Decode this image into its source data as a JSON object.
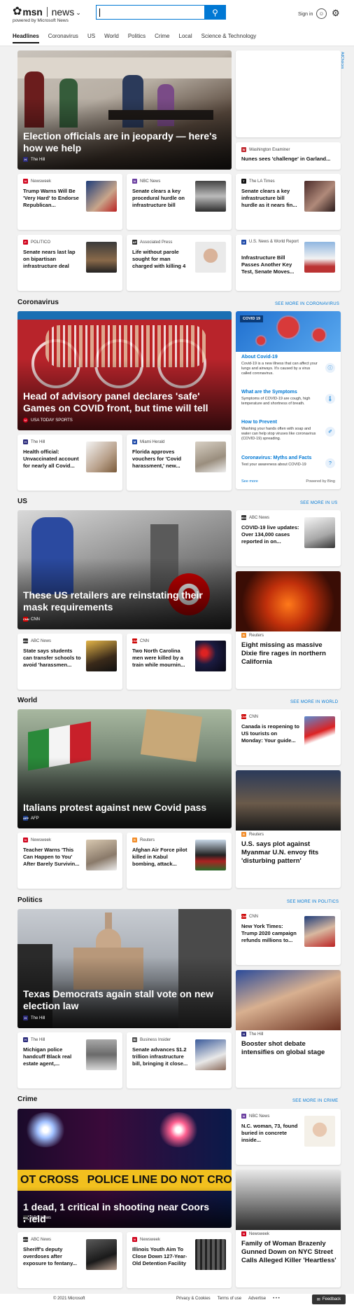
{
  "header": {
    "brand": "msn",
    "section": "news",
    "powered_by": "powered by Microsoft News",
    "signin": "Sign in"
  },
  "tabs": [
    "Headlines",
    "Coronavirus",
    "US",
    "World",
    "Politics",
    "Crime",
    "Local",
    "Science & Technology"
  ],
  "adchoices": "AdChoices",
  "top": {
    "hero": {
      "title": "Election officials are in jeopardy — here's how we help",
      "source": "The Hill"
    },
    "side": {
      "source": "Washington Examiner",
      "title": "Nunes sees 'challenge' in Garland..."
    },
    "cards": [
      {
        "source": "Newsweek",
        "title": "Trump Warns Will Be 'Very Hard' to Endorse Republican..."
      },
      {
        "source": "NBC News",
        "title": "Senate clears a key procedural hurdle on infrastructure bill"
      },
      {
        "source": "The LA Times",
        "title": "Senate clears a key infrastructure bill hurdle as it nears fin..."
      },
      {
        "source": "POLITICO",
        "title": "Senate nears last lap on bipartisan infrastructure deal"
      },
      {
        "source": "Associated Press",
        "title": "Life without parole sought for man charged with killing 4"
      },
      {
        "source": "U.S. News & World Report",
        "title": "Infrastructure Bill Passes Another Key Test, Senate Moves..."
      }
    ]
  },
  "coronavirus": {
    "title": "Coronavirus",
    "see_more": "SEE MORE IN CORONAVIRUS",
    "hero": {
      "title": "Head of advisory panel declares 'safe' Games on COVID front, but time will tell",
      "source": "USA TODAY SPORTS"
    },
    "cards": [
      {
        "source": "The Hill",
        "title": "Health official: Unvaccinated account for nearly all Covid..."
      },
      {
        "source": "Miami Herald",
        "title": "Florida approves vouchers for 'Covid harassment,' new..."
      }
    ],
    "panel": {
      "tag": "COVID 19",
      "items": [
        {
          "title": "About Covid-19",
          "desc": "Covid-19 is a new illness that can affect your lungs and airways. It's caused by a virus called coronavirus."
        },
        {
          "title": "What are the Symptoms",
          "desc": "Symptoms of COVID-19 are cough, high temperature and shortness of breath."
        },
        {
          "title": "How to Prevent",
          "desc": "Washing your hands often with soap and water can help stop viruses like coronavirus (COVID-19) spreading."
        },
        {
          "title": "Coronavirus: Myths and Facts",
          "desc": "Test your awareness about COVID-19"
        }
      ],
      "see_more": "See more",
      "powered": "Powered by Bing"
    }
  },
  "us": {
    "title": "US",
    "see_more": "SEE MORE IN US",
    "hero": {
      "title": "These US retailers are reinstating their mask requirements",
      "source": "CNN"
    },
    "side": {
      "source": "ABC News",
      "title": "COVID-19 live updates: Over 134,000 cases reported in on..."
    },
    "big": {
      "source": "Reuters",
      "title": "Eight missing as massive Dixie fire rages in northern California"
    },
    "cards": [
      {
        "source": "ABC News",
        "title": "State says students can transfer schools to avoid 'harassmen..."
      },
      {
        "source": "CNN",
        "title": "Two North Carolina men were killed by a train while mournin..."
      }
    ]
  },
  "world": {
    "title": "World",
    "see_more": "SEE MORE IN WORLD",
    "hero": {
      "title": "Italians protest against new Covid pass",
      "source": "AFP"
    },
    "side": {
      "source": "CNN",
      "title": "Canada is reopening to US tourists on Monday: Your guide..."
    },
    "big": {
      "source": "Reuters",
      "title": "U.S. says plot against Myanmar U.N. envoy fits 'disturbing pattern'"
    },
    "cards": [
      {
        "source": "Newsweek",
        "title": "Teacher Warns 'This Can Happen to You' After Barely Survivin..."
      },
      {
        "source": "Reuters",
        "title": "Afghan Air Force pilot killed in Kabul bombing, attack..."
      }
    ]
  },
  "politics": {
    "title": "Politics",
    "see_more": "SEE MORE IN POLITICS",
    "hero": {
      "title": "Texas Democrats again stall vote on new election law",
      "source": "The Hill"
    },
    "side": {
      "source": "CNN",
      "title": "New York Times: Trump 2020 campaign refunds millions to..."
    },
    "big": {
      "source": "The Hill",
      "title": "Booster shot debate intensifies on global stage"
    },
    "cards": [
      {
        "source": "The Hill",
        "title": "Michigan police handcuff Black real estate agent,..."
      },
      {
        "source": "Business Insider",
        "title": "Senate advances $1.2 trillion infrastructure bill, bringing it close..."
      }
    ]
  },
  "crime": {
    "title": "Crime",
    "see_more": "SEE MORE IN CRIME",
    "hero": {
      "title": "1 dead, 1 critical in shooting near Coors Field",
      "source": "ABC News"
    },
    "tape_text": "POLICE LINE DO NOT CROSS",
    "tape_left": "OT CROSS",
    "side": {
      "source": "NBC News",
      "title": "N.C. woman, 73, found buried in concrete inside..."
    },
    "big": {
      "source": "Newsweek",
      "title": "Family of Woman Brazenly Gunned Down on NYC Street Calls Alleged Killer 'Heartless'"
    },
    "cards": [
      {
        "source": "ABC News",
        "title": "Sheriff's deputy overdoses after exposure to fentany..."
      },
      {
        "source": "Newsweek",
        "title": "Illinois Youth Aim To Close Down 127-Year-Old Detention Facility"
      }
    ]
  },
  "footer": {
    "copyright": "© 2021 Microsoft",
    "links": [
      "Privacy & Cookies",
      "Terms of use",
      "Advertise",
      "• • •"
    ],
    "feedback": "Feedback"
  }
}
